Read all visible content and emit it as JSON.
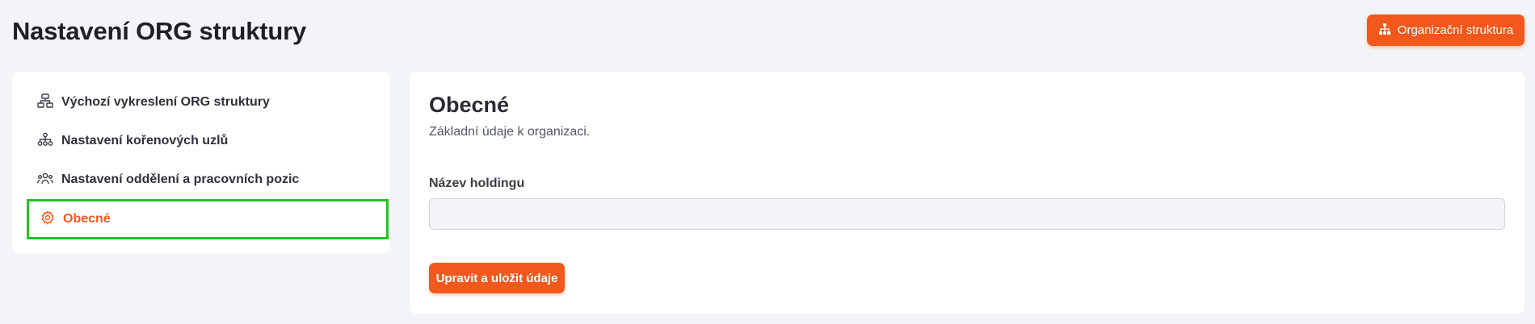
{
  "header": {
    "title": "Nastavení ORG struktury",
    "org_button": {
      "label": "Organizační struktura",
      "icon": "sitemap-icon"
    }
  },
  "sidebar": {
    "items": [
      {
        "label": "Výchozí vykreslení ORG struktury",
        "icon": "network-tree-icon",
        "active": false
      },
      {
        "label": "Nastavení kořenových uzlů",
        "icon": "hierarchy-icon",
        "active": false
      },
      {
        "label": "Nastavení oddělení a pracovních pozic",
        "icon": "team-icon",
        "active": false
      },
      {
        "label": "Obecné",
        "icon": "gear-icon",
        "active": true
      }
    ]
  },
  "panel": {
    "title": "Obecné",
    "subtitle": "Základní údaje k organizaci.",
    "holding_label": "Název holdingu",
    "holding_value": "",
    "save_label": "Upravit a uložit údaje"
  },
  "colors": {
    "accent": "#f2581c",
    "background": "#f3f4f7",
    "highlight": "#22c322"
  }
}
